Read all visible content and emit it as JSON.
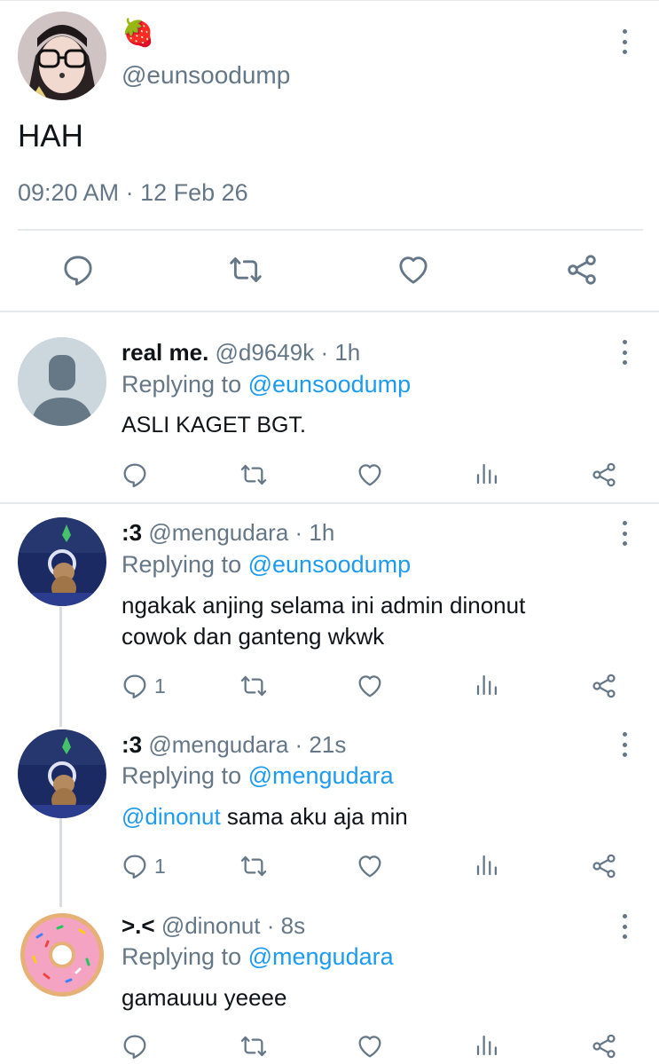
{
  "tweet": {
    "emoji": "🍓",
    "handle": "@eunsoodump",
    "text": "HAH",
    "timestamp": "09:20 AM · 12 Feb 26"
  },
  "replies": [
    {
      "name": "real me.",
      "handle": "@d9649k",
      "time": "· 1h",
      "replying_prefix": "Replying to",
      "replying_to": "@eunsoodump",
      "text_line1": "ASLI KAGET BGT.",
      "reply_count": ""
    },
    {
      "name": ":3",
      "handle": "@mengudara",
      "time": "· 1h",
      "replying_prefix": "Replying to",
      "replying_to": "@eunsoodump",
      "text_line1": "ngakak anjing selama ini admin dinonut",
      "text_line2": "cowok dan ganteng wkwk",
      "reply_count": "1"
    },
    {
      "name": ":3",
      "handle": "@mengudara",
      "time": "· 21s",
      "replying_prefix": "Replying to",
      "replying_to": "@mengudara",
      "mention": "@dinonut",
      "text_line1": " sama aku aja min",
      "reply_count": "1"
    },
    {
      "name": ">.<",
      "handle": "@dinonut",
      "time": "· 8s",
      "replying_prefix": "Replying to",
      "replying_to": "@mengudara",
      "text_line1": "gamauuu yeeee",
      "reply_count": ""
    }
  ],
  "colors": {
    "accent": "#1d9bf0",
    "muted": "#657786",
    "divider": "#e6e9ec"
  }
}
